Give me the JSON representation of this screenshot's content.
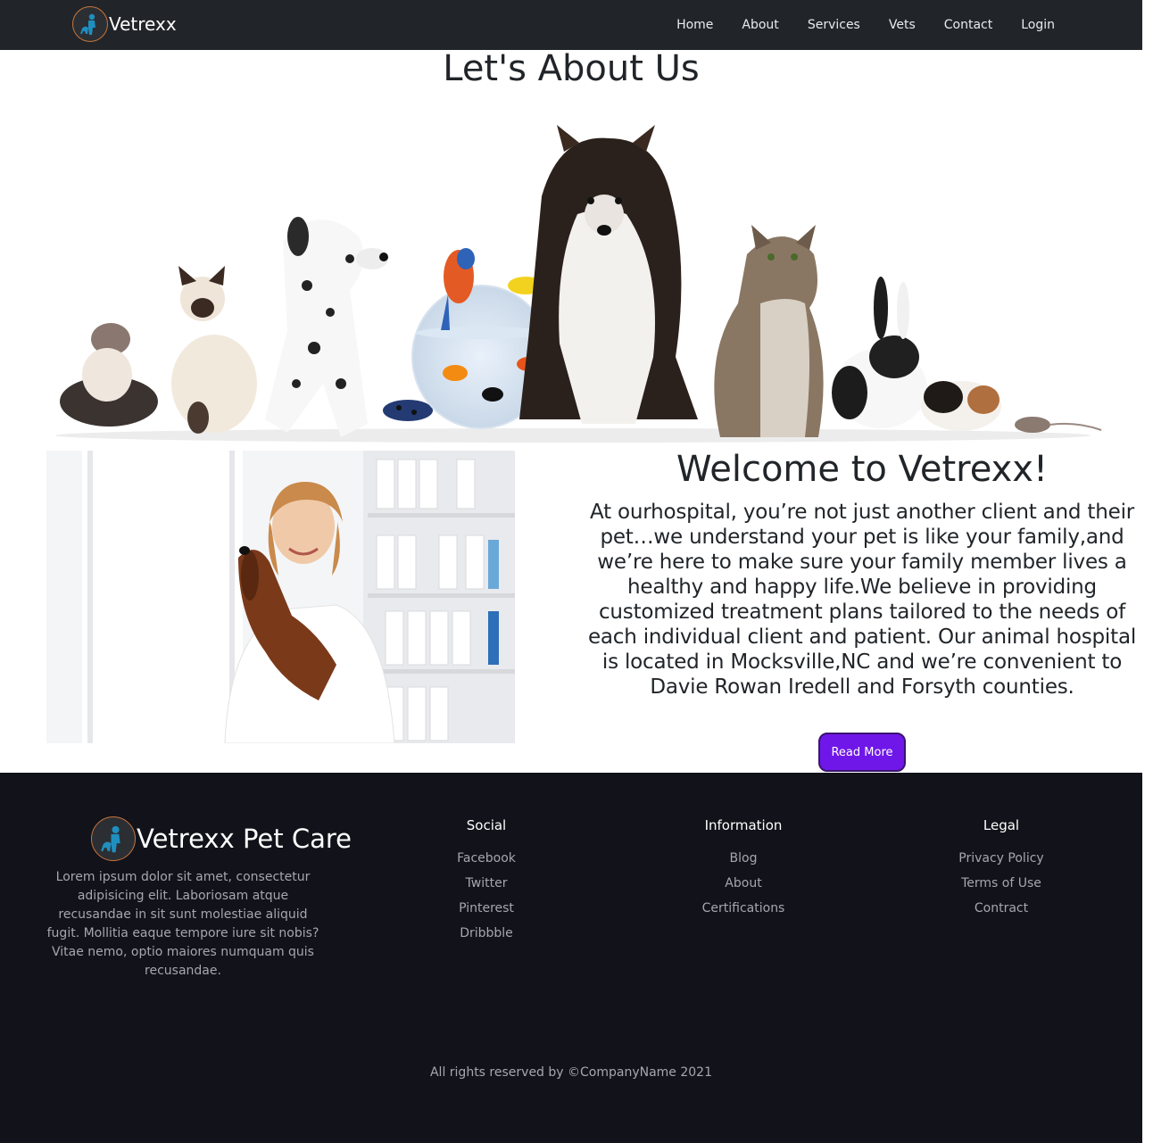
{
  "navbar": {
    "brand": "Vetrexx",
    "links": [
      "Home",
      "About",
      "Services",
      "Vets",
      "Contact",
      "Login"
    ]
  },
  "about": {
    "title": "Let's About Us"
  },
  "welcome": {
    "title": "Welcome to Vetrexx!",
    "text": "At ourhospital, you’re not just another client and their pet…we understand your pet is like your family,and we’re here to make sure your family member lives a healthy and happy life.We believe in providing customized treatment plans tailored to the needs of each individual client and patient. Our animal hospital is located in Mocksville,NC and we’re convenient to Davie Rowan Iredell and Forsyth counties.",
    "button": "Read More"
  },
  "footer": {
    "brand": "Vetrexx Pet Care",
    "description": "Lorem ipsum dolor sit amet, consectetur adipisicing elit. Laboriosam atque recusandae in sit sunt molestiae aliquid fugit. Mollitia eaque tempore iure sit nobis? Vitae nemo, optio maiores numquam quis recusandae.",
    "columns": [
      {
        "title": "Social",
        "links": [
          "Facebook",
          "Twitter",
          "Pinterest",
          "Dribbble"
        ]
      },
      {
        "title": "Information",
        "links": [
          "Blog",
          "About",
          "Certifications"
        ]
      },
      {
        "title": "Legal",
        "links": [
          "Privacy Policy",
          "Terms of Use",
          "Contract"
        ]
      }
    ],
    "copyright": "All rights reserved by ©CompanyName 2021"
  },
  "colors": {
    "navbar_bg": "#212529",
    "footer_bg": "#12121a",
    "accent_button": "#6f17e8",
    "logo_ring": "#c8743a",
    "logo_figure": "#1f8fc0"
  },
  "icons": [
    "vet-logo-icon"
  ]
}
